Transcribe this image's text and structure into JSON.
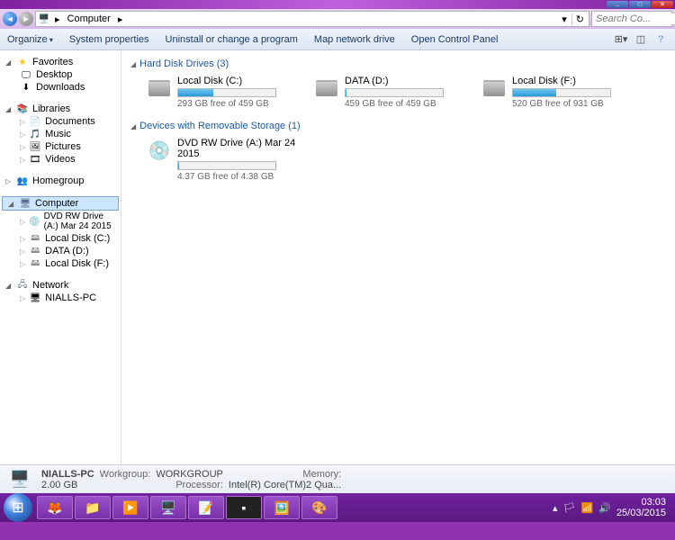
{
  "window": {
    "breadcrumb": [
      "Computer"
    ],
    "search_placeholder": "Search Co..."
  },
  "toolbar": {
    "organize": "Organize",
    "sys_props": "System properties",
    "uninstall": "Uninstall or change a program",
    "map_drive": "Map network drive",
    "ctrl_panel": "Open Control Panel"
  },
  "nav": {
    "favorites": {
      "label": "Favorites",
      "items": [
        "Desktop",
        "Downloads"
      ]
    },
    "libraries": {
      "label": "Libraries",
      "items": [
        "Documents",
        "Music",
        "Pictures",
        "Videos"
      ]
    },
    "homegroup": {
      "label": "Homegroup"
    },
    "computer": {
      "label": "Computer",
      "items": [
        "DVD RW Drive (A:) Mar 24 2015",
        "Local Disk (C:)",
        "DATA (D:)",
        "Local Disk (F:)"
      ]
    },
    "network": {
      "label": "Network",
      "items": [
        "NIALLS-PC"
      ]
    }
  },
  "content": {
    "cat1": "Hard Disk Drives (3)",
    "cat2": "Devices with Removable Storage (1)",
    "drives": [
      {
        "name": "Local Disk (C:)",
        "free": "293 GB free of 459 GB",
        "pct": 36
      },
      {
        "name": "DATA (D:)",
        "free": "459 GB free of 459 GB",
        "pct": 1
      },
      {
        "name": "Local Disk (F:)",
        "free": "520 GB free of 931 GB",
        "pct": 44
      }
    ],
    "removable": [
      {
        "name": "DVD RW Drive (A:) Mar 24 2015",
        "free": "4.37 GB free of 4.38 GB",
        "pct": 1
      }
    ]
  },
  "details": {
    "name": "NIALLS-PC",
    "wg_label": "Workgroup:",
    "workgroup": "WORKGROUP",
    "mem_label": "Memory:",
    "memory": "2.00 GB",
    "proc_label": "Processor:",
    "processor": "Intel(R) Core(TM)2 Qua..."
  },
  "taskbar": {
    "time": "03:03",
    "date": "25/03/2015"
  }
}
